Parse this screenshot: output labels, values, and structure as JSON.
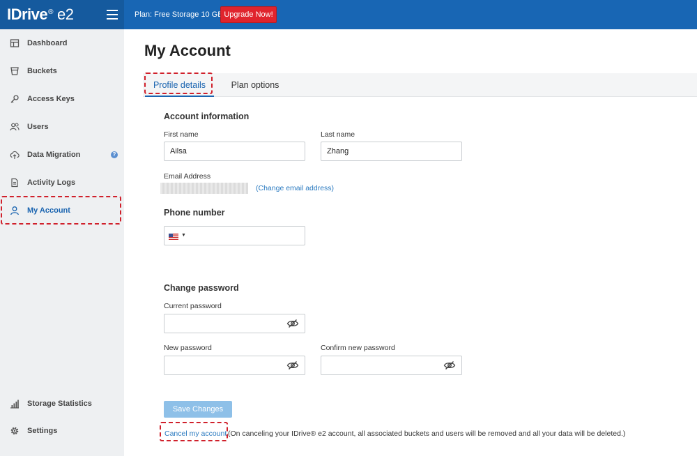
{
  "brand": {
    "name": "IDrive",
    "reg": "®",
    "product": "e2"
  },
  "topbar": {
    "plan": "Plan: Free Storage 10 GB",
    "upgrade_label": "Upgrade Now!"
  },
  "sidebar": {
    "items": [
      {
        "label": "Dashboard",
        "icon": "dashboard-icon"
      },
      {
        "label": "Buckets",
        "icon": "bucket-icon"
      },
      {
        "label": "Access Keys",
        "icon": "key-icon"
      },
      {
        "label": "Users",
        "icon": "users-icon"
      },
      {
        "label": "Data Migration",
        "icon": "cloud-migration-icon",
        "badge": "?"
      },
      {
        "label": "Activity Logs",
        "icon": "document-icon"
      },
      {
        "label": "My Account",
        "icon": "user-icon",
        "active": true
      }
    ],
    "bottom_items": [
      {
        "label": "Storage Statistics",
        "icon": "bar-chart-icon"
      },
      {
        "label": "Settings",
        "icon": "gear-icon"
      }
    ]
  },
  "page": {
    "title": "My Account",
    "tabs": [
      {
        "label": "Profile details",
        "active": true
      },
      {
        "label": "Plan options",
        "active": false
      }
    ]
  },
  "profile": {
    "account_section": "Account information",
    "first_name_label": "First name",
    "first_name_value": "Ailsa",
    "last_name_label": "Last name",
    "last_name_value": "Zhang",
    "email_label": "Email Address",
    "change_email_link": "(Change email address)",
    "phone_section": "Phone number",
    "password_section": "Change password",
    "current_password_label": "Current password",
    "new_password_label": "New password",
    "confirm_password_label": "Confirm new password",
    "save_label": "Save Changes",
    "cancel_link": "Cancel my account",
    "cancel_note": "(On canceling your IDrive® e2 account, all associated buckets and users will be removed and all your data will be deleted.)"
  },
  "colors": {
    "topbar": "#1866b4",
    "upgrade": "#e0242d",
    "accent": "#1a64b0",
    "highlight": "#d0202b"
  }
}
